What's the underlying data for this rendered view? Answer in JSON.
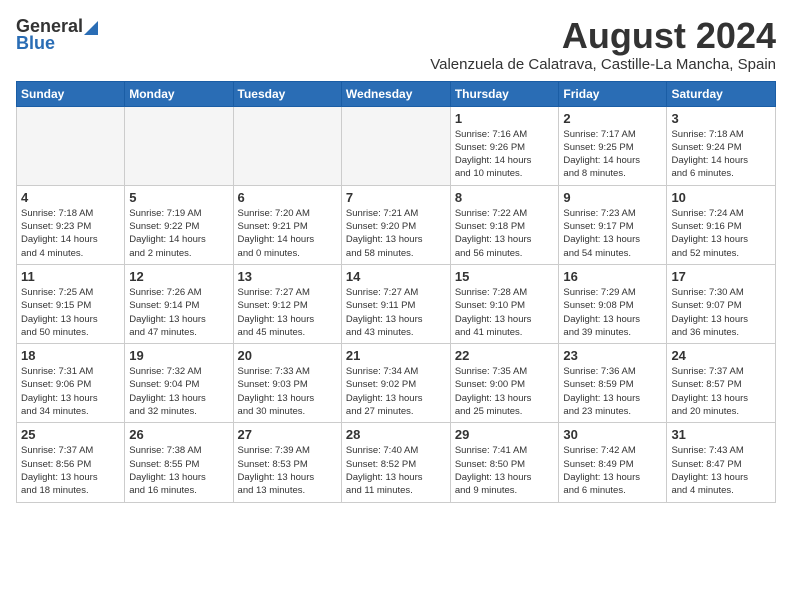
{
  "header": {
    "logo_general": "General",
    "logo_blue": "Blue",
    "month": "August 2024",
    "location": "Valenzuela de Calatrava, Castille-La Mancha, Spain"
  },
  "days_of_week": [
    "Sunday",
    "Monday",
    "Tuesday",
    "Wednesday",
    "Thursday",
    "Friday",
    "Saturday"
  ],
  "weeks": [
    [
      {
        "day": "",
        "info": ""
      },
      {
        "day": "",
        "info": ""
      },
      {
        "day": "",
        "info": ""
      },
      {
        "day": "",
        "info": ""
      },
      {
        "day": "1",
        "info": "Sunrise: 7:16 AM\nSunset: 9:26 PM\nDaylight: 14 hours\nand 10 minutes."
      },
      {
        "day": "2",
        "info": "Sunrise: 7:17 AM\nSunset: 9:25 PM\nDaylight: 14 hours\nand 8 minutes."
      },
      {
        "day": "3",
        "info": "Sunrise: 7:18 AM\nSunset: 9:24 PM\nDaylight: 14 hours\nand 6 minutes."
      }
    ],
    [
      {
        "day": "4",
        "info": "Sunrise: 7:18 AM\nSunset: 9:23 PM\nDaylight: 14 hours\nand 4 minutes."
      },
      {
        "day": "5",
        "info": "Sunrise: 7:19 AM\nSunset: 9:22 PM\nDaylight: 14 hours\nand 2 minutes."
      },
      {
        "day": "6",
        "info": "Sunrise: 7:20 AM\nSunset: 9:21 PM\nDaylight: 14 hours\nand 0 minutes."
      },
      {
        "day": "7",
        "info": "Sunrise: 7:21 AM\nSunset: 9:20 PM\nDaylight: 13 hours\nand 58 minutes."
      },
      {
        "day": "8",
        "info": "Sunrise: 7:22 AM\nSunset: 9:18 PM\nDaylight: 13 hours\nand 56 minutes."
      },
      {
        "day": "9",
        "info": "Sunrise: 7:23 AM\nSunset: 9:17 PM\nDaylight: 13 hours\nand 54 minutes."
      },
      {
        "day": "10",
        "info": "Sunrise: 7:24 AM\nSunset: 9:16 PM\nDaylight: 13 hours\nand 52 minutes."
      }
    ],
    [
      {
        "day": "11",
        "info": "Sunrise: 7:25 AM\nSunset: 9:15 PM\nDaylight: 13 hours\nand 50 minutes."
      },
      {
        "day": "12",
        "info": "Sunrise: 7:26 AM\nSunset: 9:14 PM\nDaylight: 13 hours\nand 47 minutes."
      },
      {
        "day": "13",
        "info": "Sunrise: 7:27 AM\nSunset: 9:12 PM\nDaylight: 13 hours\nand 45 minutes."
      },
      {
        "day": "14",
        "info": "Sunrise: 7:27 AM\nSunset: 9:11 PM\nDaylight: 13 hours\nand 43 minutes."
      },
      {
        "day": "15",
        "info": "Sunrise: 7:28 AM\nSunset: 9:10 PM\nDaylight: 13 hours\nand 41 minutes."
      },
      {
        "day": "16",
        "info": "Sunrise: 7:29 AM\nSunset: 9:08 PM\nDaylight: 13 hours\nand 39 minutes."
      },
      {
        "day": "17",
        "info": "Sunrise: 7:30 AM\nSunset: 9:07 PM\nDaylight: 13 hours\nand 36 minutes."
      }
    ],
    [
      {
        "day": "18",
        "info": "Sunrise: 7:31 AM\nSunset: 9:06 PM\nDaylight: 13 hours\nand 34 minutes."
      },
      {
        "day": "19",
        "info": "Sunrise: 7:32 AM\nSunset: 9:04 PM\nDaylight: 13 hours\nand 32 minutes."
      },
      {
        "day": "20",
        "info": "Sunrise: 7:33 AM\nSunset: 9:03 PM\nDaylight: 13 hours\nand 30 minutes."
      },
      {
        "day": "21",
        "info": "Sunrise: 7:34 AM\nSunset: 9:02 PM\nDaylight: 13 hours\nand 27 minutes."
      },
      {
        "day": "22",
        "info": "Sunrise: 7:35 AM\nSunset: 9:00 PM\nDaylight: 13 hours\nand 25 minutes."
      },
      {
        "day": "23",
        "info": "Sunrise: 7:36 AM\nSunset: 8:59 PM\nDaylight: 13 hours\nand 23 minutes."
      },
      {
        "day": "24",
        "info": "Sunrise: 7:37 AM\nSunset: 8:57 PM\nDaylight: 13 hours\nand 20 minutes."
      }
    ],
    [
      {
        "day": "25",
        "info": "Sunrise: 7:37 AM\nSunset: 8:56 PM\nDaylight: 13 hours\nand 18 minutes."
      },
      {
        "day": "26",
        "info": "Sunrise: 7:38 AM\nSunset: 8:55 PM\nDaylight: 13 hours\nand 16 minutes."
      },
      {
        "day": "27",
        "info": "Sunrise: 7:39 AM\nSunset: 8:53 PM\nDaylight: 13 hours\nand 13 minutes."
      },
      {
        "day": "28",
        "info": "Sunrise: 7:40 AM\nSunset: 8:52 PM\nDaylight: 13 hours\nand 11 minutes."
      },
      {
        "day": "29",
        "info": "Sunrise: 7:41 AM\nSunset: 8:50 PM\nDaylight: 13 hours\nand 9 minutes."
      },
      {
        "day": "30",
        "info": "Sunrise: 7:42 AM\nSunset: 8:49 PM\nDaylight: 13 hours\nand 6 minutes."
      },
      {
        "day": "31",
        "info": "Sunrise: 7:43 AM\nSunset: 8:47 PM\nDaylight: 13 hours\nand 4 minutes."
      }
    ]
  ]
}
